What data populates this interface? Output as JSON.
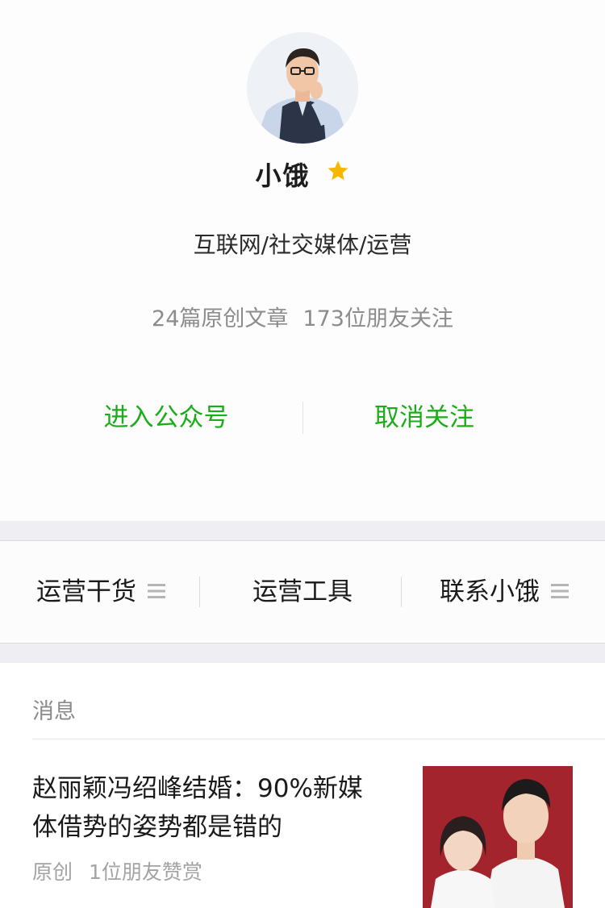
{
  "profile": {
    "name": "小饿",
    "bio": "互联网/社交媒体/运营",
    "articles_count": "24篇原创文章",
    "followers_count": "173位朋友关注",
    "actions": {
      "enter": "进入公众号",
      "unfollow": "取消关注"
    }
  },
  "menu": {
    "items": [
      {
        "label": "运营干货",
        "has_submenu": true
      },
      {
        "label": "运营工具",
        "has_submenu": false
      },
      {
        "label": "联系小饿",
        "has_submenu": true
      }
    ]
  },
  "messages": {
    "section_title": "消息",
    "articles": [
      {
        "title": "赵丽颖冯绍峰结婚：90%新媒体借势的姿势都是错的",
        "tag": "原创",
        "meta": "1位朋友赞赏"
      }
    ]
  },
  "colors": {
    "accent_green": "#1aad19",
    "star": "#f5b700",
    "secondary_text": "#8c8c8c",
    "divider_bg": "#efeff3"
  },
  "icons": {
    "star": "star-icon",
    "submenu": "menu-lines-icon"
  }
}
